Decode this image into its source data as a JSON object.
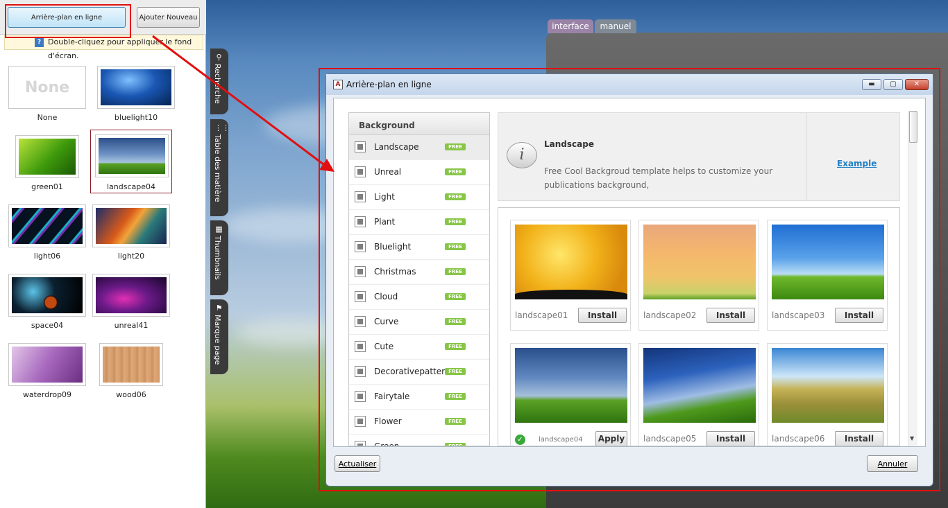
{
  "left_panel": {
    "online_button": "Arrière-plan en ligne",
    "add_button": "Ajouter Nouveau",
    "hint": "Double-cliquez pour appliquer le fond d'écran.",
    "hint_icon": "info-icon",
    "thumbnails": [
      {
        "label": "None",
        "preview_text": "None"
      },
      {
        "label": "bluelight10"
      },
      {
        "label": "green01"
      },
      {
        "label": "landscape04"
      },
      {
        "label": "light06"
      },
      {
        "label": "light20"
      },
      {
        "label": "space04"
      },
      {
        "label": "unreal41"
      },
      {
        "label": "waterdrop09"
      },
      {
        "label": "wood06"
      }
    ]
  },
  "side_tabs": [
    {
      "label": "Recherche",
      "icon": "search-icon"
    },
    {
      "label": "Table des matière",
      "icon": "toc-icon"
    },
    {
      "label": "Thumbnails",
      "icon": "grid-icon"
    },
    {
      "label": "Marque page",
      "icon": "bookmark-icon"
    }
  ],
  "book_tabs": [
    "interface",
    "manuel"
  ],
  "dialog": {
    "title": "Arrière-plan en ligne",
    "window_buttons": {
      "minimize": "minimize-icon",
      "maximize": "maximize-icon",
      "close": "close-icon"
    },
    "category_header": "Background",
    "free_badge": "FREE",
    "categories": [
      "Landscape",
      "Unreal",
      "Light",
      "Plant",
      "Bluelight",
      "Christmas",
      "Cloud",
      "Curve",
      "Cute",
      "Decorativepattern",
      "Fairytale",
      "Flower",
      "Green"
    ],
    "selected_category": "Landscape",
    "info": {
      "title": "Landscape",
      "description": "Free Cool Backgroud template helps to customize your publications background,",
      "example_link": "Example"
    },
    "items": [
      {
        "name": "landscape01",
        "action": "Install",
        "applied": false
      },
      {
        "name": "landscape02",
        "action": "Install",
        "applied": false
      },
      {
        "name": "landscape03",
        "action": "Install",
        "applied": false
      },
      {
        "name": "landscape04",
        "action": "Apply",
        "applied": true
      },
      {
        "name": "landscape05",
        "action": "Install",
        "applied": false
      },
      {
        "name": "landscape06",
        "action": "Install",
        "applied": false
      }
    ],
    "refresh_button": "Actualiser",
    "cancel_button": "Annuler"
  },
  "colors": {
    "highlight_red": "#e01010",
    "free_badge": "#87c646",
    "link": "#1f7fc6"
  }
}
